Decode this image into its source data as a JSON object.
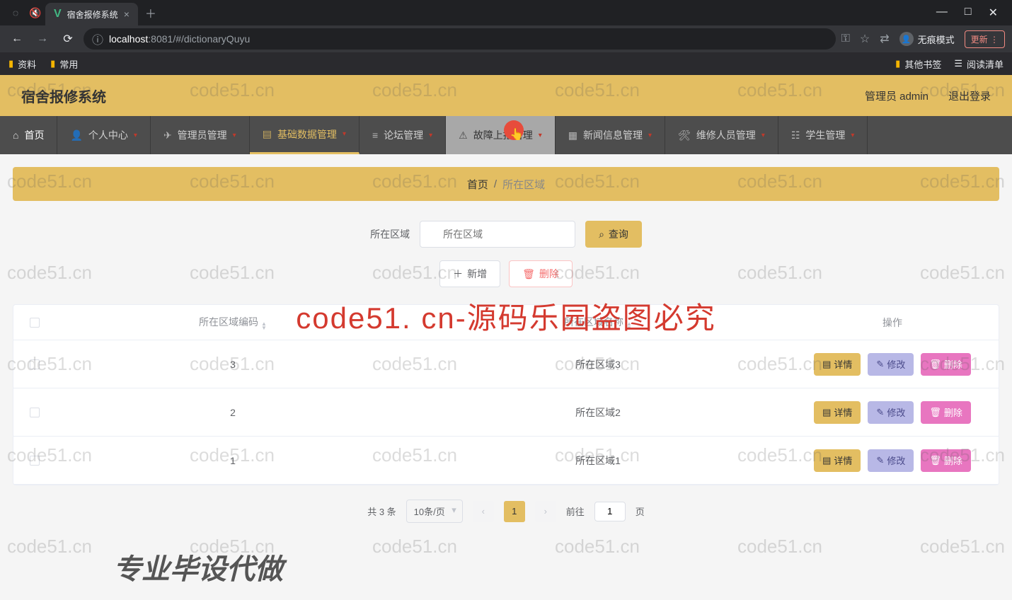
{
  "browser": {
    "tab_title": "宿舍报修系统",
    "url_host": "localhost",
    "url_port": ":8081",
    "url_path": "/#/dictionaryQuyu",
    "incognito": "无痕模式",
    "update": "更新",
    "bookmarks": {
      "b1": "资料",
      "b2": "常用",
      "other": "其他书签",
      "read": "阅读清单"
    }
  },
  "app": {
    "title": "宿舍报修系统",
    "user": "管理员 admin",
    "logout": "退出登录"
  },
  "nav": {
    "home": "首页",
    "personal": "个人中心",
    "admin": "管理员管理",
    "basedata": "基础数据管理",
    "forum": "论坛管理",
    "fault": "故障上报管理",
    "news": "新闻信息管理",
    "repair": "维修人员管理",
    "student": "学生管理"
  },
  "breadcrumb": {
    "home": "首页",
    "current": "所在区域"
  },
  "search": {
    "label": "所在区域",
    "placeholder": "所在区域",
    "query": "查询"
  },
  "actions": {
    "add": "新增",
    "del": "删除"
  },
  "table": {
    "col_code": "所在区域编码",
    "col_name": "所在区域名称",
    "col_ops": "操作",
    "rows": [
      {
        "code": "3",
        "name": "所在区域3"
      },
      {
        "code": "2",
        "name": "所在区域2"
      },
      {
        "code": "1",
        "name": "所在区域1"
      }
    ],
    "btn_detail": "详情",
    "btn_edit": "修改",
    "btn_del": "删除"
  },
  "pagination": {
    "total": "共 3 条",
    "size": "10条/页",
    "current": "1",
    "goto_pre": "前往",
    "goto_val": "1",
    "goto_suf": "页"
  },
  "watermark": "code51.cn",
  "overlay_big": "code51. cn-源码乐园盗图必究",
  "overlay_bottom": "专业毕设代做"
}
